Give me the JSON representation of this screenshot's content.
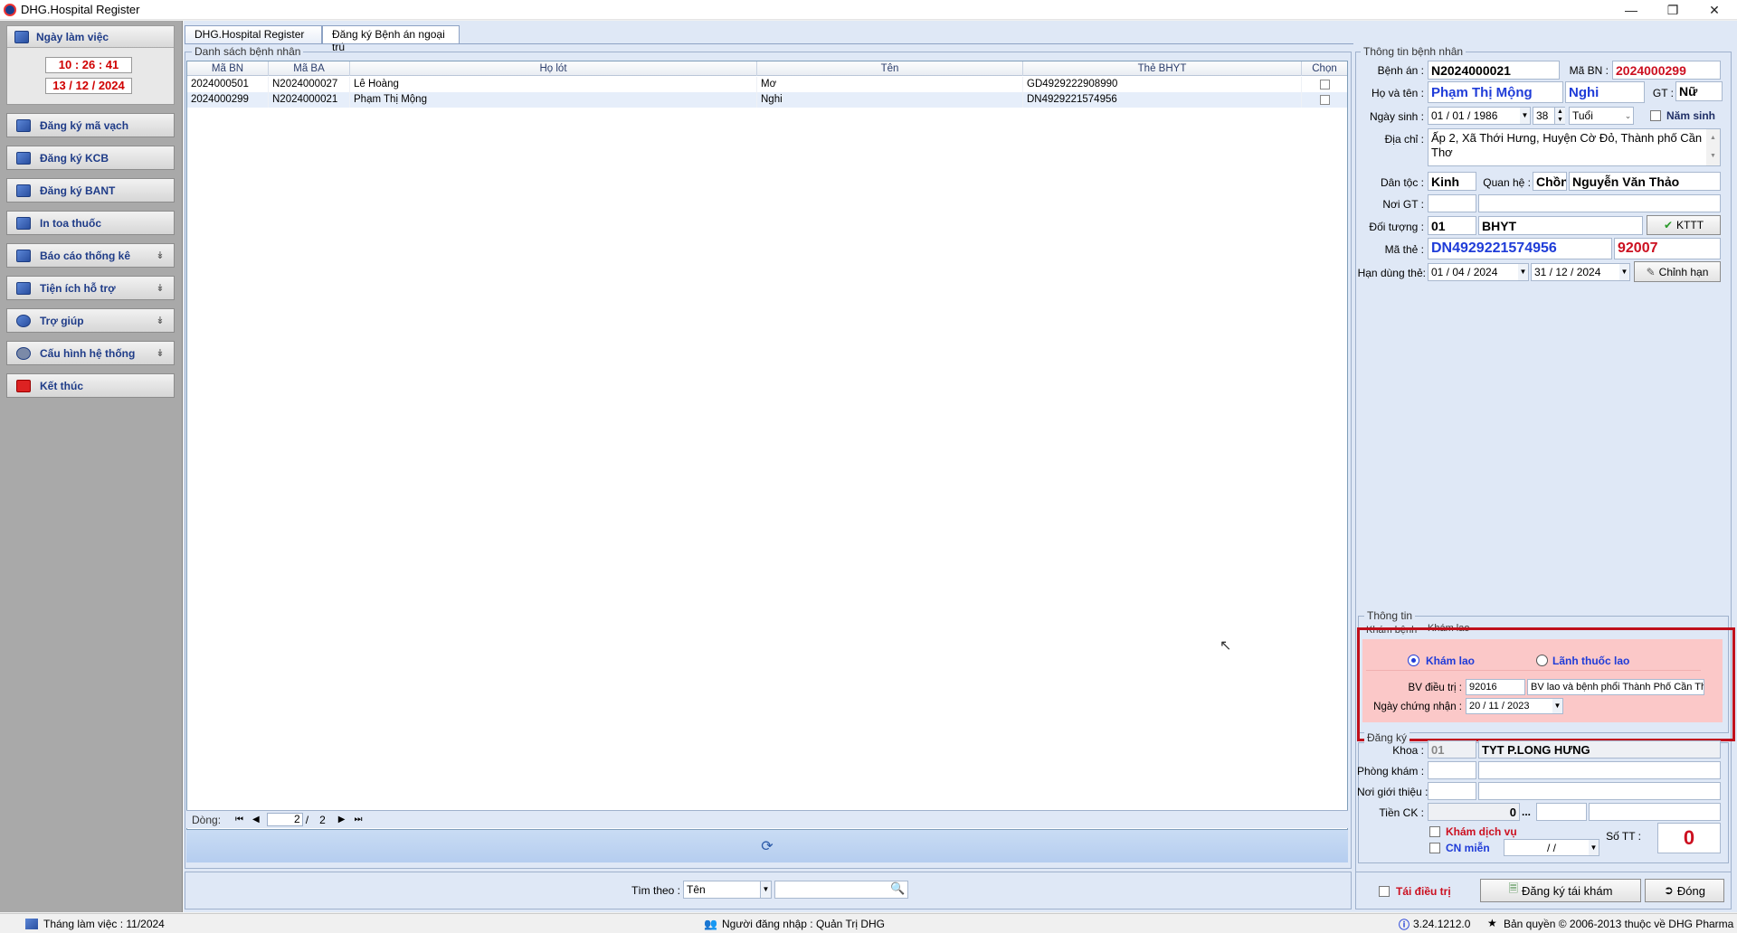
{
  "window": {
    "title": "DHG.Hospital Register"
  },
  "sidebar": {
    "work_day_label": "Ngày làm việc",
    "time": "10 : 26 : 41",
    "date": "13 / 12 / 2024",
    "items": [
      {
        "label": "Đăng ký mã vạch",
        "expandable": false
      },
      {
        "label": "Đăng ký KCB",
        "expandable": false
      },
      {
        "label": "Đăng ký BANT",
        "expandable": false
      },
      {
        "label": "In toa thuốc",
        "expandable": false
      },
      {
        "label": "Báo cáo thống kê",
        "expandable": true
      },
      {
        "label": "Tiện ích hỗ trợ",
        "expandable": true
      },
      {
        "label": "Trợ giúp",
        "expandable": true
      },
      {
        "label": "Cấu hình hệ thống",
        "expandable": true
      },
      {
        "label": "Kết thúc",
        "expandable": false
      }
    ]
  },
  "tabs": [
    {
      "label": "DHG.Hospital Register"
    },
    {
      "label": "Đăng ký Bệnh án ngoại trú"
    }
  ],
  "patient_list": {
    "title": "Danh sách bệnh nhân",
    "columns": [
      "Mã BN",
      "Mã BA",
      "Họ lót",
      "Tên",
      "Thẻ BHYT",
      "Chọn"
    ],
    "rows": [
      [
        "2024000501",
        "N2024000027",
        "Lê Hoàng",
        "Mơ",
        "GD4929222908990"
      ],
      [
        "2024000299",
        "N2024000021",
        "Phạm Thị Mộng",
        "Nghi",
        "DN4929221574956"
      ]
    ],
    "pager": {
      "label": "Dòng:",
      "current": "2",
      "separator": "/",
      "total": "2"
    }
  },
  "patient_info": {
    "title": "Thông tin bệnh nhân",
    "benh_an_label": "Bệnh án :",
    "benh_an": "N2024000021",
    "ma_bn_label": "Mã BN :",
    "ma_bn": "2024000299",
    "ho_ten_label": "Họ và tên :",
    "ho_lot": "Phạm Thị Mộng",
    "ten": "Nghi",
    "gt_label": "GT :",
    "gt": "Nữ",
    "ngay_sinh_label": "Ngày sinh :",
    "ngay_sinh": "01 / 01 / 1986",
    "tuoi": "38",
    "tuoi_unit": "Tuổi",
    "nam_sinh_label": "Năm sinh",
    "dia_chi_label": "Địa chỉ :",
    "dia_chi": "Ấp 2, Xã Thới Hưng, Huyện Cờ Đỏ, Thành phố Cần Thơ",
    "dan_toc_label": "Dân tộc :",
    "dan_toc": "Kinh",
    "quan_he_label": "Quan hệ :",
    "quan_he": "Chồn",
    "nguoi_than": "Nguyễn Văn Thảo",
    "noi_gt_label": "Nơi GT :",
    "doi_tuong_label": "Đối tượng :",
    "doi_tuong_code": "01",
    "doi_tuong": "BHYT",
    "kttt_label": "KTTT",
    "ma_the_label": "Mã thẻ :",
    "ma_the": "DN4929221574956",
    "ma_kcb": "92007",
    "han_dung_label": "Hạn dùng thẻ:",
    "han_tu": "01 / 04 / 2024",
    "han_den": "31 / 12 / 2024",
    "chinh_han_label": "Chỉnh hạn"
  },
  "thong_tin": {
    "title": "Thông tin",
    "kham_benh_label": "Khám bệnh",
    "kham_benh_value": "Khám lao",
    "radio_kham_lao": "Khám lao",
    "radio_lanh_thuoc": "Lãnh thuốc lao",
    "bv_dieu_tri_label": "BV điều trị :",
    "bv_code": "92016",
    "bv_name": "BV lao và bệnh phổi Thành Phố Cần Thơ",
    "ngay_chung_nhan_label": "Ngày chứng nhận :",
    "ngay_chung_nhan": "20 / 11 / 2023"
  },
  "dang_ky": {
    "title": "Đăng ký",
    "khoa_label": "Khoa :",
    "khoa_code": "01",
    "khoa_name": "TYT P.LONG HƯNG",
    "phong_kham_label": "Phòng khám :",
    "noi_gioi_thieu_label": "Nơi giới thiệu :",
    "tien_ck_label": "Tiền CK :",
    "tien_ck": "0",
    "tien_ck_btn": "...",
    "kham_dich_vu_label": "Khám dịch vụ",
    "cn_mien_label": "CN miễn",
    "cn_mien_date": " /  / ",
    "so_tt_label": "Số TT :",
    "so_tt": "0"
  },
  "search": {
    "label": "Tìm theo :",
    "field": "Tên",
    "value": ""
  },
  "actions": {
    "tai_dieu_tri": "Tái điều trị",
    "dang_ky_tai_kham": "Đăng ký tái khám",
    "dong": "Đóng"
  },
  "statusbar": {
    "thang": "Tháng làm việc : 11/2024",
    "user": "Người đăng nhập : Quản Trị DHG",
    "version": "3.24.1212.0",
    "copyright": "Bản quyền © 2006-2013 thuộc về DHG Pharma"
  },
  "colors": {
    "accent_red": "#cc1020",
    "highlight_border": "#c0101c",
    "highlight_fill": "#fbc8c8",
    "name_blue": "#1f3cd8"
  }
}
